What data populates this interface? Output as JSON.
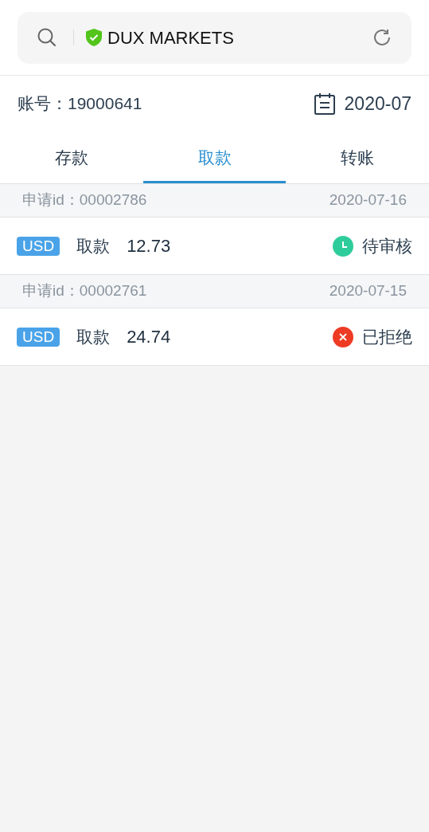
{
  "address_bar": {
    "site": "DUX MARKETS"
  },
  "account": {
    "label": "账号：",
    "number": "19000641",
    "month": "2020-07"
  },
  "tabs": [
    {
      "label": "存款",
      "selected": false
    },
    {
      "label": "取款",
      "selected": true
    },
    {
      "label": "转账",
      "selected": false
    }
  ],
  "records": [
    {
      "id_label": "申请id：",
      "id": "00002786",
      "date": "2020-07-16",
      "currency": "USD",
      "type": "取款",
      "amount": "12.73",
      "status": {
        "kind": "pending",
        "label": "待审核",
        "color": "#2ecc9a"
      }
    },
    {
      "id_label": "申请id：",
      "id": "00002761",
      "date": "2020-07-15",
      "currency": "USD",
      "type": "取款",
      "amount": "24.74",
      "status": {
        "kind": "rejected",
        "label": "已拒绝",
        "color": "#ee3b24"
      }
    }
  ]
}
